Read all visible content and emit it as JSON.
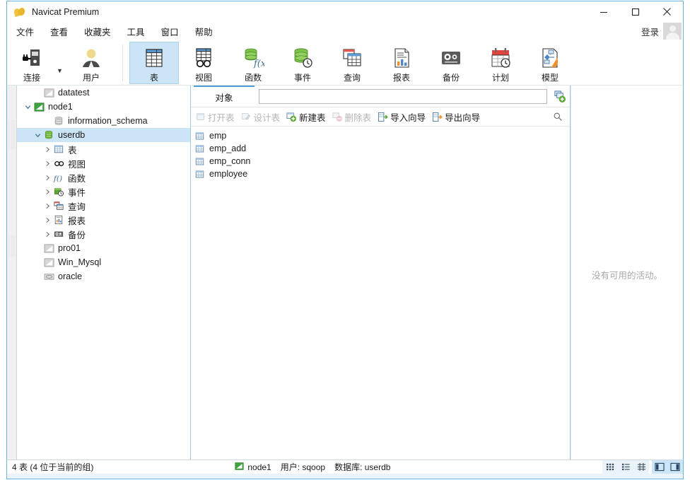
{
  "window": {
    "title": "Navicat Premium",
    "icon": "navicat-logo-icon",
    "minimize": "−",
    "maximize": "□",
    "close": "✕"
  },
  "menubar": {
    "items": [
      {
        "label": "文件",
        "name": "menu-file"
      },
      {
        "label": "查看",
        "name": "menu-view"
      },
      {
        "label": "收藏夹",
        "name": "menu-favorites"
      },
      {
        "label": "工具",
        "name": "menu-tools"
      },
      {
        "label": "窗口",
        "name": "menu-window"
      },
      {
        "label": "帮助",
        "name": "menu-help"
      }
    ],
    "login_label": "登录"
  },
  "toolbar": {
    "items": [
      {
        "label": "连接",
        "icon": "connection-icon",
        "selected": false,
        "has_dropdown": true
      },
      {
        "label": "用户",
        "icon": "user-icon",
        "selected": false,
        "has_dropdown": false
      },
      {
        "label": "表",
        "icon": "table-icon",
        "selected": true,
        "has_dropdown": false
      },
      {
        "label": "视图",
        "icon": "view-icon",
        "selected": false,
        "has_dropdown": false
      },
      {
        "label": "函数",
        "icon": "function-icon",
        "selected": false,
        "has_dropdown": false
      },
      {
        "label": "事件",
        "icon": "event-icon",
        "selected": false,
        "has_dropdown": false
      },
      {
        "label": "查询",
        "icon": "query-icon",
        "selected": false,
        "has_dropdown": false
      },
      {
        "label": "报表",
        "icon": "report-icon",
        "selected": false,
        "has_dropdown": false
      },
      {
        "label": "备份",
        "icon": "backup-icon",
        "selected": false,
        "has_dropdown": false
      },
      {
        "label": "计划",
        "icon": "schedule-icon",
        "selected": false,
        "has_dropdown": false
      },
      {
        "label": "模型",
        "icon": "model-icon",
        "selected": false,
        "has_dropdown": false
      }
    ]
  },
  "sidebar": {
    "nodes": [
      {
        "label": "datatest",
        "icon": "mysql-conn-icon-grey",
        "indent": 1,
        "twisty": "",
        "selected": false
      },
      {
        "label": "node1",
        "icon": "mysql-conn-icon-green",
        "indent": 0,
        "twisty": "expanded",
        "selected": false
      },
      {
        "label": "information_schema",
        "icon": "database-icon-grey",
        "indent": 2,
        "twisty": "",
        "selected": false
      },
      {
        "label": "userdb",
        "icon": "database-icon-green",
        "indent": 1,
        "twisty": "expanded",
        "selected": true
      },
      {
        "label": "表",
        "icon": "table-icon",
        "indent": 2,
        "twisty": "collapsed",
        "selected": false
      },
      {
        "label": "视图",
        "icon": "view-icon",
        "indent": 2,
        "twisty": "collapsed",
        "selected": false
      },
      {
        "label": "函数",
        "icon": "function-icon",
        "indent": 2,
        "twisty": "collapsed",
        "selected": false
      },
      {
        "label": "事件",
        "icon": "event-icon",
        "indent": 2,
        "twisty": "collapsed",
        "selected": false
      },
      {
        "label": "查询",
        "icon": "query-icon",
        "indent": 2,
        "twisty": "collapsed",
        "selected": false
      },
      {
        "label": "报表",
        "icon": "report-icon",
        "indent": 2,
        "twisty": "collapsed",
        "selected": false
      },
      {
        "label": "备份",
        "icon": "backup-icon",
        "indent": 2,
        "twisty": "collapsed",
        "selected": false
      },
      {
        "label": "pro01",
        "icon": "mysql-conn-icon-grey",
        "indent": 1,
        "twisty": "",
        "selected": false
      },
      {
        "label": "Win_Mysql",
        "icon": "mysql-conn-icon-grey",
        "indent": 1,
        "twisty": "",
        "selected": false
      },
      {
        "label": "oracle",
        "icon": "oracle-conn-icon-grey",
        "indent": 1,
        "twisty": "",
        "selected": false
      }
    ]
  },
  "objects": {
    "tab_label": "对象",
    "address_value": "",
    "address_placeholder": "",
    "add_button_icon": "new-connection-icon",
    "actions": [
      {
        "label": "打开表",
        "icon": "open-table-icon",
        "enabled": false
      },
      {
        "label": "设计表",
        "icon": "design-table-icon",
        "enabled": false
      },
      {
        "label": "新建表",
        "icon": "new-table-icon",
        "enabled": true
      },
      {
        "label": "删除表",
        "icon": "delete-table-icon",
        "enabled": false
      },
      {
        "label": "导入向导",
        "icon": "import-wizard-icon",
        "enabled": true
      },
      {
        "label": "导出向导",
        "icon": "export-wizard-icon",
        "enabled": true
      }
    ],
    "search_icon": "search-icon",
    "tables": [
      {
        "name": "emp",
        "icon": "table-icon"
      },
      {
        "name": "emp_add",
        "icon": "table-icon"
      },
      {
        "name": "emp_conn",
        "icon": "table-icon"
      },
      {
        "name": "employee",
        "icon": "table-icon"
      }
    ]
  },
  "right_panel": {
    "empty_text": "没有可用的活动。"
  },
  "statusbar": {
    "count_text": "4 表 (4 位于当前的组)",
    "connection": "node1",
    "user": "用户: sqoop",
    "database": "数据库: userdb",
    "view_modes": [
      {
        "name": "grid-view-icon",
        "selected": false
      },
      {
        "name": "list-view-icon",
        "selected": false
      },
      {
        "name": "detail-view-icon",
        "selected": false
      }
    ],
    "panel_toggles": [
      {
        "name": "toggle-left-panel-icon"
      },
      {
        "name": "toggle-right-panel-icon"
      }
    ]
  },
  "colors": {
    "accent": "#6cb5e0",
    "selection": "#cce5f6",
    "green": "#5aa832",
    "orange": "#f08a1e",
    "muted": "#a8a8a8"
  }
}
